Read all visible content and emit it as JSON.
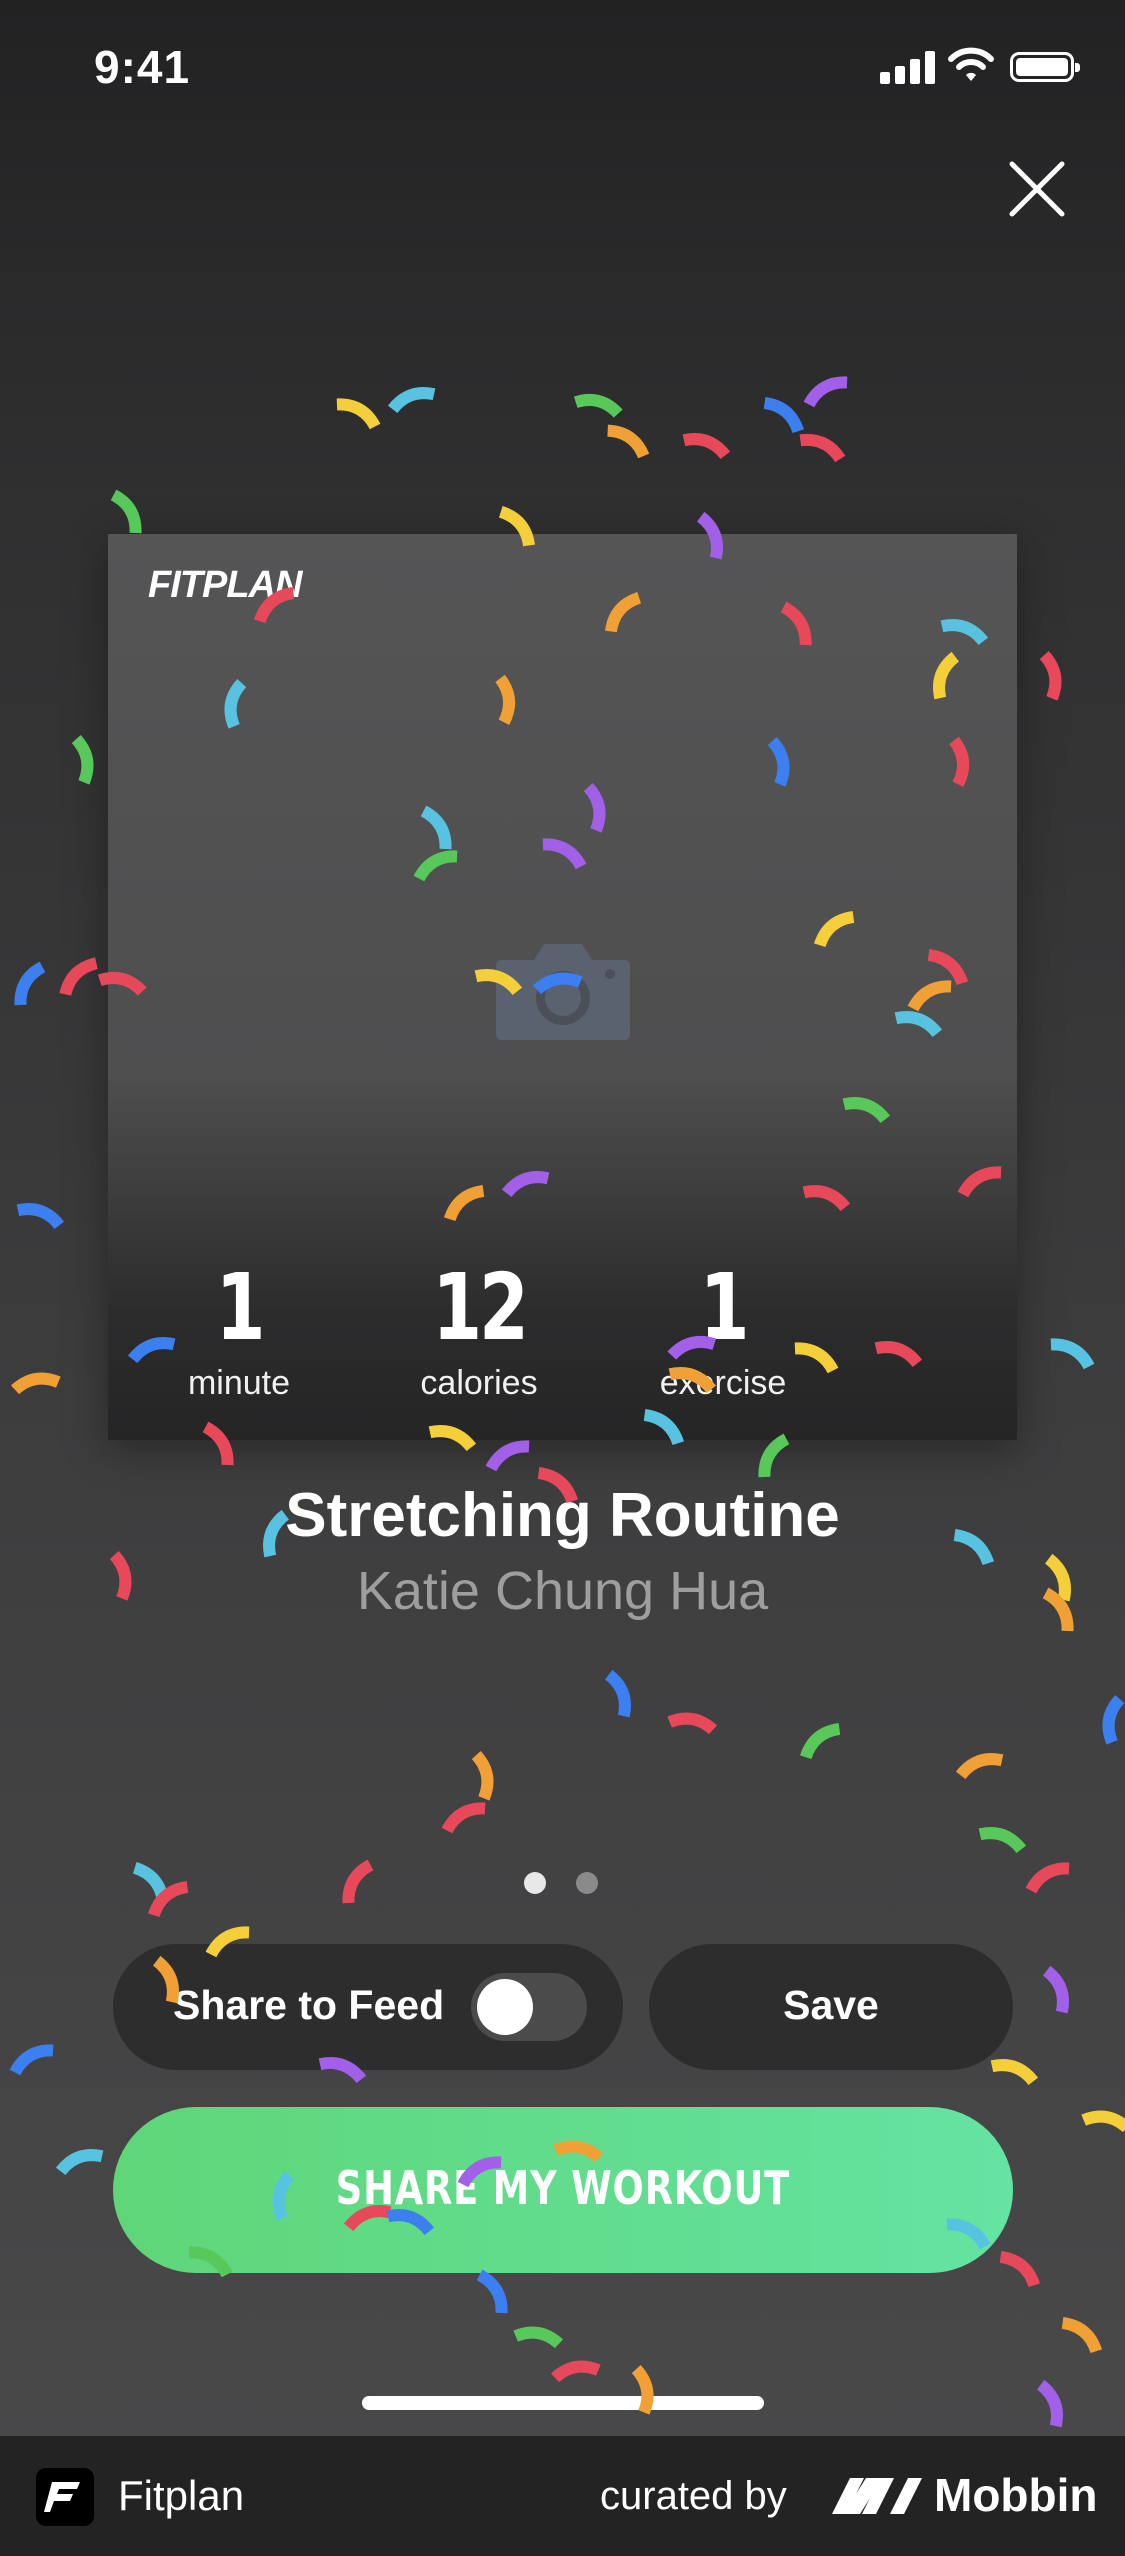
{
  "status_bar": {
    "time": "9:41"
  },
  "card": {
    "brand": "FITPLAN",
    "stats": [
      {
        "value": "1",
        "label": "minute"
      },
      {
        "value": "12",
        "label": "calories"
      },
      {
        "value": "1",
        "label": "exercise"
      }
    ]
  },
  "workout": {
    "title": "Stretching Routine",
    "trainer": "Katie Chung Hua"
  },
  "pager": {
    "count": 2,
    "active": 0
  },
  "actions": {
    "share_to_feed_label": "Share to Feed",
    "share_to_feed_on": false,
    "save_label": "Save",
    "share_button_label": "SHARE MY WORKOUT"
  },
  "footer": {
    "app_name": "Fitplan",
    "curated_by": "curated by",
    "brand": "Mobbin"
  },
  "colors": {
    "cta_start": "#5fd678",
    "cta_end": "#64e3a2",
    "confetti": [
      "#f5cf3a",
      "#58c3e0",
      "#f0a035",
      "#e8495a",
      "#3b7ff0",
      "#a25fe8",
      "#58c85a"
    ]
  }
}
